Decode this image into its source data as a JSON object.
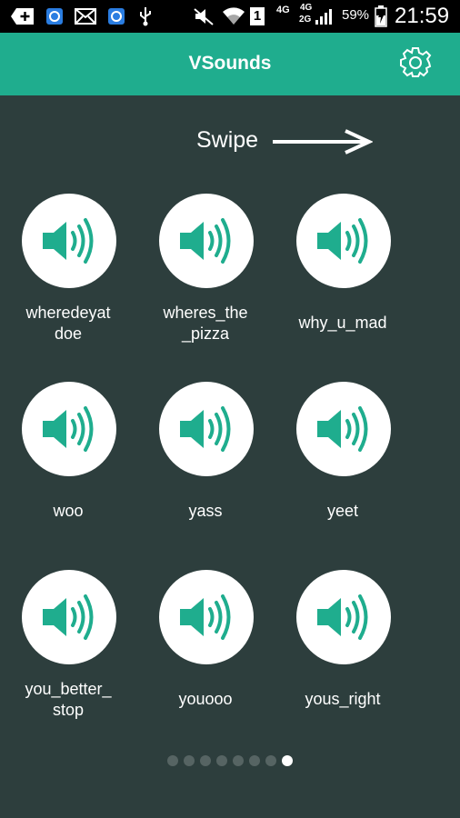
{
  "statusbar": {
    "battery_percent": "59%",
    "time": "21:59",
    "network_a": "4G",
    "network_b": "4G",
    "network_c": "2G",
    "sim_slot": "1"
  },
  "appbar": {
    "title": "VSounds"
  },
  "hint": {
    "text": "Swipe"
  },
  "sounds": [
    {
      "label": "wheredeyat\ndoe"
    },
    {
      "label": "wheres_the\n_pizza"
    },
    {
      "label": "why_u_mad"
    },
    {
      "label": "woo"
    },
    {
      "label": "yass"
    },
    {
      "label": "yeet"
    },
    {
      "label": "you_better_\nstop"
    },
    {
      "label": "youooo"
    },
    {
      "label": "yous_right"
    }
  ],
  "pager": {
    "total": 8,
    "active_index": 7
  },
  "colors": {
    "accent": "#1fad8e",
    "background": "#2d3e3d",
    "speaker": "#1fad8e"
  }
}
